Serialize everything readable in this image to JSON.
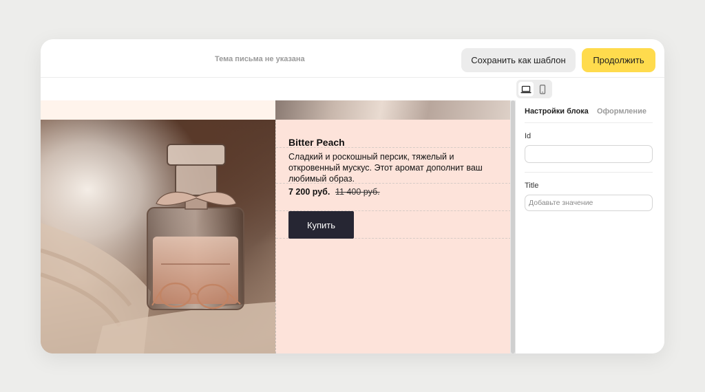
{
  "header": {
    "subject": "Тема письма не указана",
    "save_template_label": "Сохранить как шаблон",
    "continue_label": "Продолжить"
  },
  "toolbar": {
    "devices": [
      "desktop-icon",
      "mobile-icon"
    ],
    "active_device": "desktop"
  },
  "product": {
    "title": "Bitter Peach",
    "description": "Сладкий и роскошный персик, тяжелый и откровенный мускус. Этот аромат дополнит ваш любимый образ.",
    "price": "7 200 руб.",
    "old_price": "11 400 руб.",
    "buy_label": "Купить"
  },
  "panel": {
    "tabs": [
      {
        "label": "Настройки блока",
        "active": true
      },
      {
        "label": "Оформление",
        "active": false
      }
    ],
    "fields": [
      {
        "label": "Id",
        "value": "",
        "placeholder": ""
      },
      {
        "label": "Title",
        "value": "",
        "placeholder": "Добавьте значение"
      }
    ]
  },
  "colors": {
    "accent": "#ffdb4d",
    "button_dark": "#262633",
    "product_bg": "#fde3da",
    "canvas_bg": "#fff4ec"
  }
}
